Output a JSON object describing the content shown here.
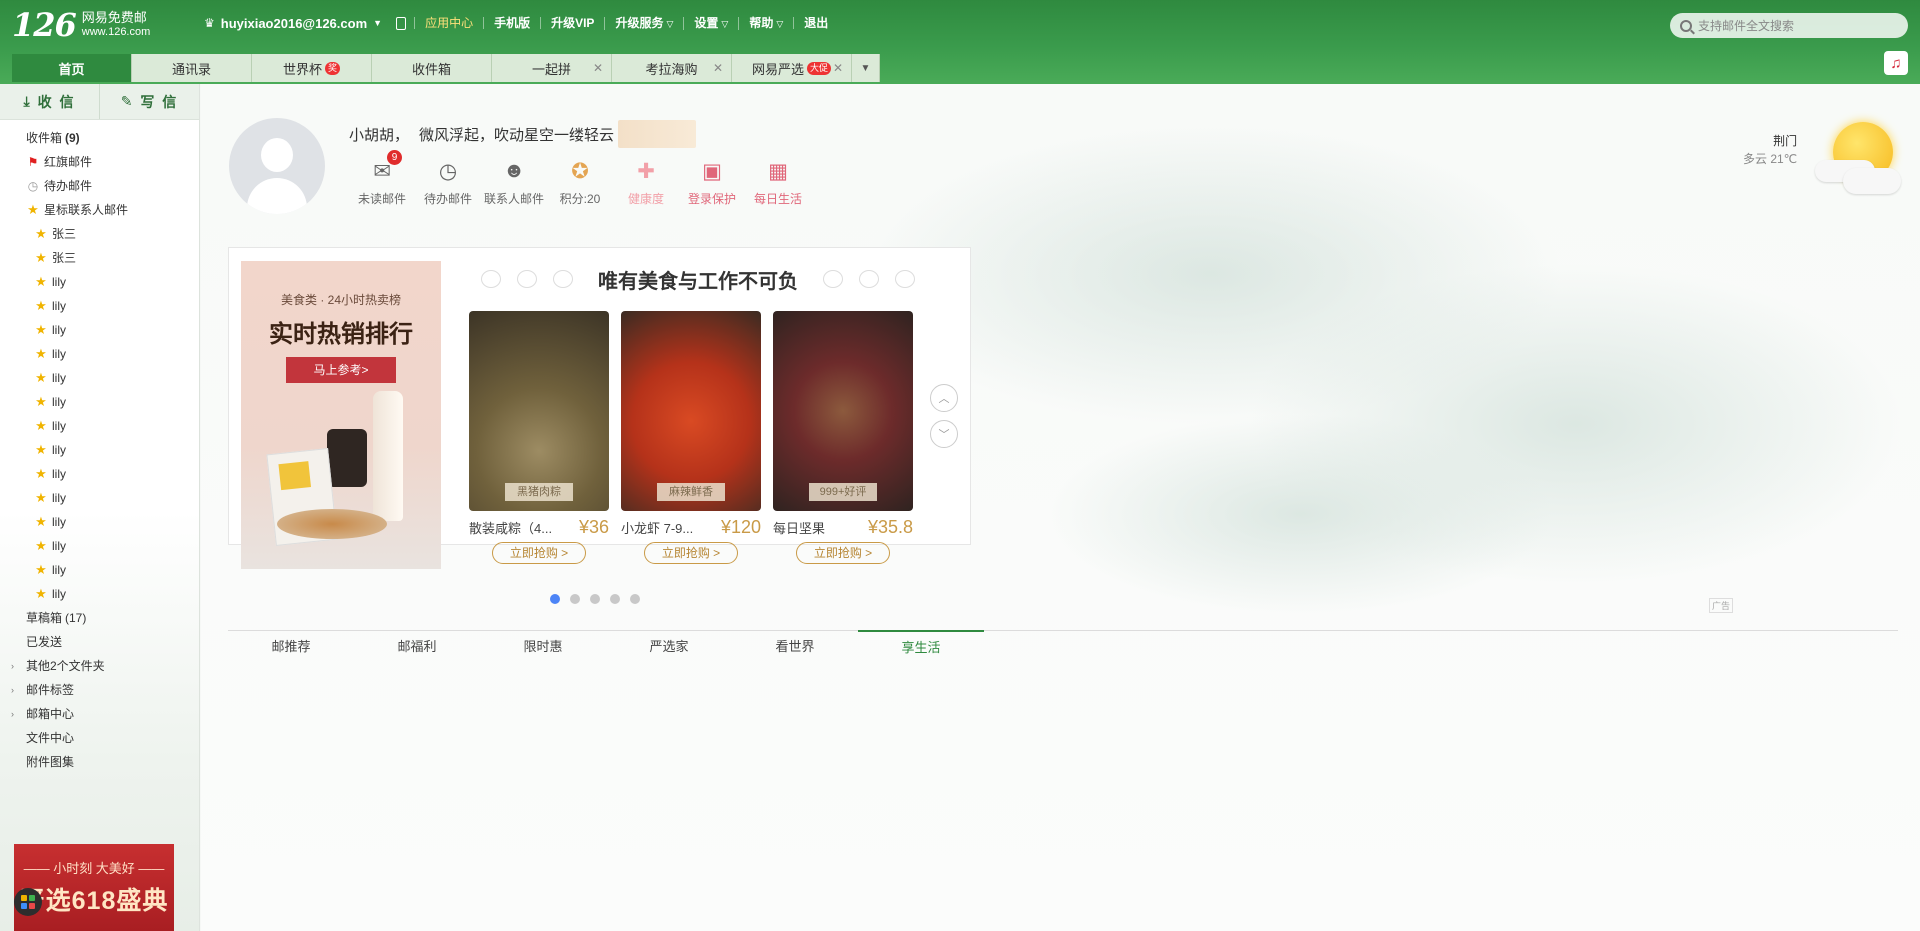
{
  "logo": {
    "number": "126",
    "name": "网易免费邮",
    "domain": "www.126.com"
  },
  "header": {
    "user": "huyixiao2016@126.com",
    "nav": [
      "应用中心",
      "手机版",
      "升级VIP",
      "升级服务",
      "设置",
      "帮助",
      "退出"
    ],
    "search_placeholder": "支持邮件全文搜索"
  },
  "tabs": [
    {
      "label": "首页",
      "active": true
    },
    {
      "label": "通讯录"
    },
    {
      "label": "世界杯",
      "badge": "奖"
    },
    {
      "label": "收件箱"
    },
    {
      "label": "一起拼",
      "closable": true
    },
    {
      "label": "考拉海购",
      "closable": true
    },
    {
      "label": "网易严选",
      "badge": "大促",
      "closable": true
    }
  ],
  "sidebar": {
    "receive": "收 信",
    "compose": "写 信",
    "inbox": {
      "label": "收件箱",
      "count": "(9)"
    },
    "flagged": "红旗邮件",
    "todo": "待办邮件",
    "starred": "星标联系人邮件",
    "starred_contacts": [
      "张三",
      "张三",
      "lily",
      "lily",
      "lily",
      "lily",
      "lily",
      "lily",
      "lily",
      "lily",
      "lily",
      "lily",
      "lily",
      "lily",
      "lily",
      "lily"
    ],
    "drafts": {
      "label": "草稿箱",
      "count": "(17)"
    },
    "sent": "已发送",
    "other_folders": "其他2个文件夹",
    "tags": "邮件标签",
    "mailbox_center": "邮箱中心",
    "file_center": "文件中心",
    "attachments": "附件图集",
    "ad_line1": "—— 小时刻 大美好 ——",
    "ad_line2": "严选618盛典"
  },
  "home": {
    "greeting_name": "小胡胡，",
    "greeting_text": "微风浮起，吹动星空一缕轻云",
    "quick": [
      {
        "label": "未读邮件",
        "badge": "9"
      },
      {
        "label": "待办邮件"
      },
      {
        "label": "联系人邮件"
      },
      {
        "label": "积分:20"
      },
      {
        "label": "健康度"
      },
      {
        "label": "登录保护"
      },
      {
        "label": "每日生活"
      }
    ],
    "weather": {
      "city": "荆门",
      "condition": "多云 21℃"
    }
  },
  "promo": {
    "banner_category": "美食类 · 24小时热卖榜",
    "banner_title": "实时热销排行",
    "banner_button": "马上参考>",
    "title": "唯有美食与工作不可负",
    "products": [
      {
        "name": "散装咸粽（4...",
        "price": "¥36",
        "tag": "黑猪肉粽",
        "buy": "立即抢购 >"
      },
      {
        "name": "小龙虾 7-9...",
        "price": "¥120",
        "tag": "麻辣鲜香",
        "buy": "立即抢购 >"
      },
      {
        "name": "每日坚果",
        "price": "¥35.8",
        "tag": "999+好评",
        "buy": "立即抢购 >"
      }
    ],
    "ad_label": "广告"
  },
  "subtabs": [
    "邮推荐",
    "邮福利",
    "限时惠",
    "严选家",
    "看世界",
    "享生活"
  ]
}
